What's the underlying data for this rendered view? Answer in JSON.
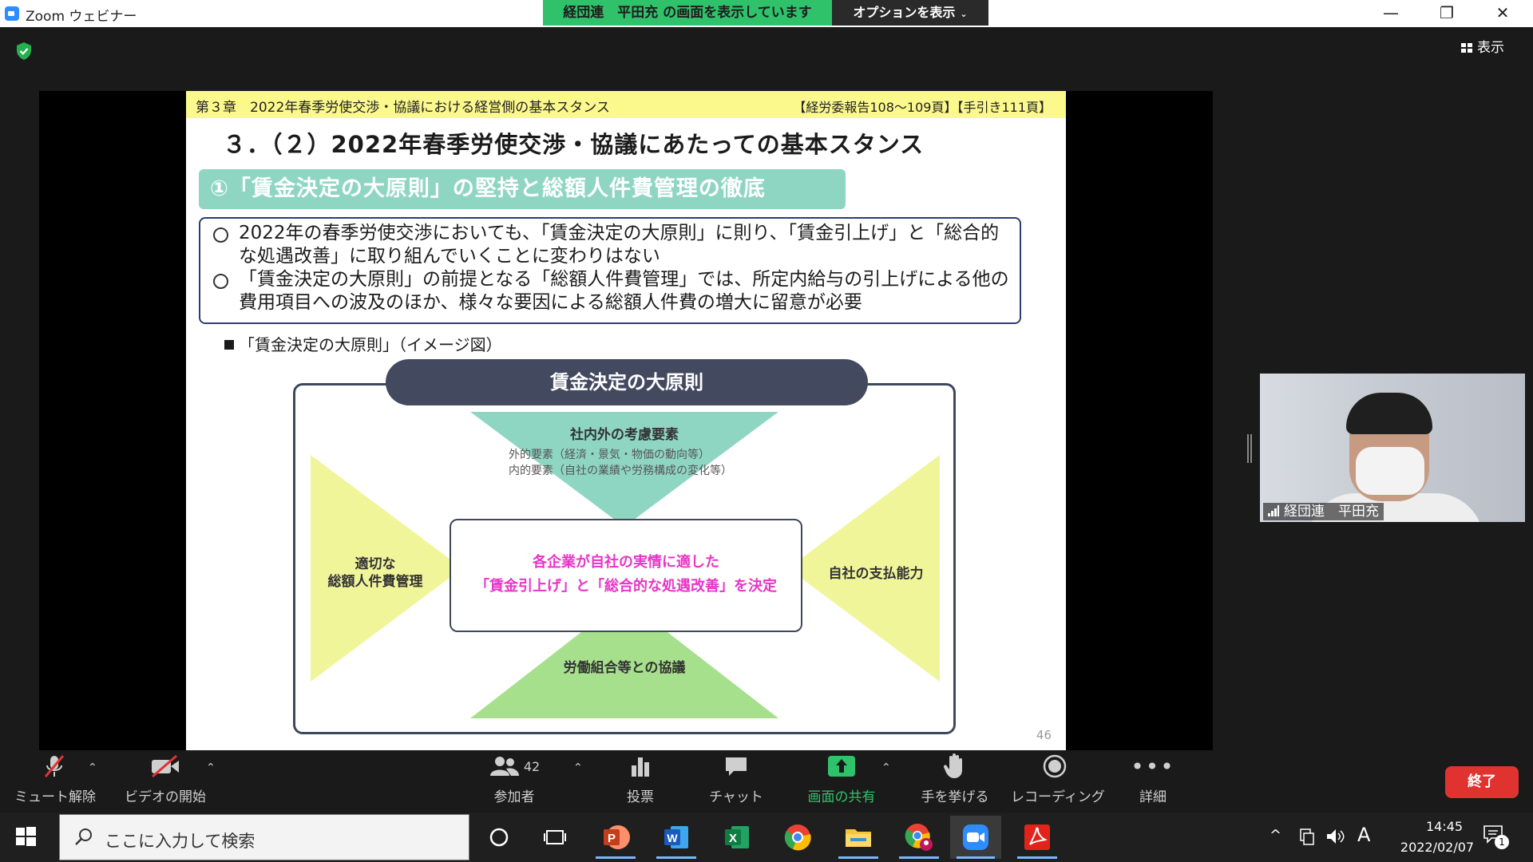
{
  "window": {
    "app_title": "Zoom ウェビナー",
    "share_banner": "経団連　平田充 の画面を表示しています",
    "options_label": "オプションを表示",
    "minimize": "—",
    "restore": "❐",
    "close": "✕"
  },
  "meeting": {
    "view_label": "表示",
    "self_name": "経団連　平田充"
  },
  "slide": {
    "chapter": "第３章　2022年春季労使交渉・協議における経営側の基本スタンス",
    "references": "【経労委報告108～109頁】【手引き111頁】",
    "title": "３．（２）2022年春季労使交渉・協議にあたっての基本スタンス",
    "section": "①「賃金決定の大原則」の堅持と総額人件費管理の徹底",
    "bullets": [
      "2022年の春季労使交渉においても、「賃金決定の大原則」に則り、「賃金引上げ」と「総合的な処遇改善」に取り組んでいくことに変わりはない",
      "「賃金決定の大原則」の前提となる「総額人件費管理」では、所定内給与の引上げによる他の費用項目への波及のほか、様々な要因による総額人件費の増大に留意が必要"
    ],
    "image_caption": "「賃金決定の大原則」（イメージ図）",
    "page_number": "46"
  },
  "diagram": {
    "title": "賃金決定の大原則",
    "top_label": "社内外の考慮要素",
    "top_sub1": "外的要素（経済・景気・物価の動向等）",
    "top_sub2": "内的要素（自社の業績や労務構成の変化等）",
    "left_label1": "適切な",
    "left_label2": "総額人件費管理",
    "right_label": "自社の支払能力",
    "bottom_label": "労働組合等との協議",
    "center_line1": "各企業が自社の実情に適した",
    "center_line2": "「賃金引上げ」と「総合的な処遇改善」を決定",
    "colors": {
      "top": "#8fd6c2",
      "side": "#f1f59a",
      "bottom": "#a6e08c",
      "center_text": "#e835c7"
    }
  },
  "controls": {
    "mute": "ミュート解除",
    "video": "ビデオの開始",
    "participants": "参加者",
    "participant_count": "42",
    "polls": "投票",
    "chat": "チャット",
    "share": "画面の共有",
    "raise_hand": "手を挙げる",
    "recording": "レコーディング",
    "more": "詳細",
    "end": "終了"
  },
  "taskbar": {
    "search_placeholder": "ここに入力して検索",
    "apps": [
      "task-view",
      "powerpoint",
      "word",
      "excel",
      "chrome",
      "file-explorer",
      "chrome-profile",
      "zoom",
      "acrobat"
    ],
    "time": "14:45",
    "date": "2022/02/07",
    "ime": "A",
    "notification_count": "1"
  }
}
